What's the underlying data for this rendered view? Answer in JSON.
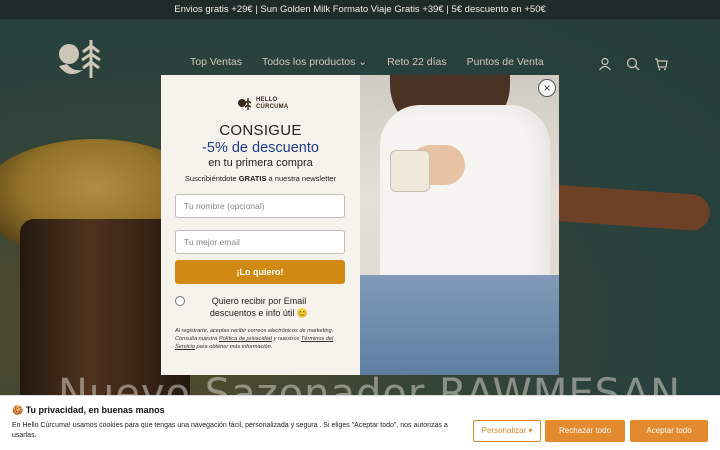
{
  "announcement": "Envios gratis +29€ |   Sun Golden Milk Formato Viaje Gratis +39€ | 5€ descuento en +50€",
  "nav": {
    "items": [
      "Top Ventas",
      "Todos los productos",
      "Reto 22 días",
      "Puntos de Venta"
    ],
    "dropdown_chevron": "⌄",
    "icons": [
      "account-icon",
      "search-icon",
      "cart-icon"
    ]
  },
  "hero": {
    "title": "Nuevo Sazonador RAWMESAN"
  },
  "popup": {
    "logo_text_line1": "HELLO",
    "logo_text_line2": "CÚRCUMA",
    "heading": "CONSIGUE",
    "discount": "-5% de descuento",
    "subheading": "en tu primera compra",
    "sub_pre": "Suscribiéntdote ",
    "sub_bold": "GRATIS",
    "sub_post": " a nuestra newsletter",
    "name_placeholder": "Tu nombre (opcional)",
    "email_placeholder": "Tu mejor email",
    "submit_label": "¡Lo quiero!",
    "checkbox_label": "Quiero recibir por Email descuentos e info útil 😊",
    "legal_1": "Al registrarte, aceptas recibir correos electrónicos de marketing. Consulta nuestra ",
    "legal_link1": "Política de privacidad",
    "legal_2": " y nuestros ",
    "legal_link2": "Términos del Servicio",
    "legal_3": " para obtener más información.",
    "close_symbol": "×"
  },
  "cookie": {
    "title": "🍪 Tu privacidad, en buenas manos",
    "text": "En Hello Cúrcuma! usamos    cookies para que tengas una navegación fácil, personalizada y segura . Si eliges \"Aceptar todo\", nos autorizas a usarlas.",
    "customize_label": "Personalizar ▾",
    "reject_label": "Rechazar todo",
    "accept_label": "Aceptar todo"
  },
  "colors": {
    "accent": "#d08a14",
    "cookie_button": "#e38a2e",
    "discount_text": "#1f3a8c"
  }
}
